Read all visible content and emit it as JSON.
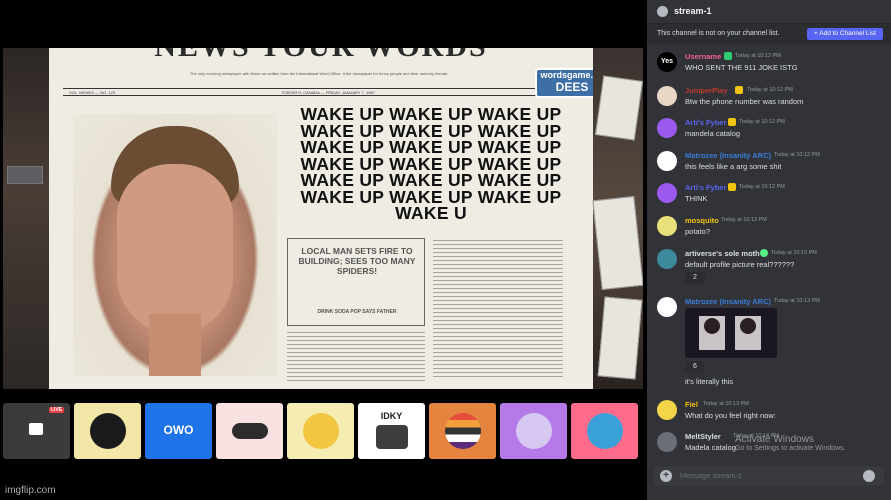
{
  "newspaper": {
    "masthead": "NEWS YOUR WORDS",
    "tagline": "The only morning newspaper with those six written from the International Word Office. It the newspaper for funny people and their unfunny friends.",
    "dateline_left": "VOL. MCMXX — NO. 123",
    "dateline_center": "TORONTO, CANADA — FRIDAY, JANUARY 7, 1967",
    "dateline_right": "EDITION",
    "logo_top": "wordsgame.lol",
    "logo_bottom": "DEES",
    "headline_lines": [
      "WAKE UP WAKE UP WAKE UP",
      "WAKE UP WAKE UP WAKE UP",
      "WAKE UP WAKE UP WAKE UP",
      "WAKE UP WAKE UP WAKE UP",
      "WAKE UP WAKE UP WAKE UP",
      "WAKE UP WAKE UP WAKE UP",
      "WAKE U"
    ],
    "box_title": "LOCAL MAN SETS FIRE TO BUILDING; SEES TOO MANY SPIDERS!",
    "box_sub": "DRINK SODA POP SAYS FATHER"
  },
  "tiles": [
    {
      "bg": "#3b3b3b",
      "label": "",
      "live": "LIVE"
    },
    {
      "bg": "#f3e7a7",
      "label": ""
    },
    {
      "bg": "#1e73e8",
      "label": "OWO"
    },
    {
      "bg": "#f7e1e1",
      "label": ""
    },
    {
      "bg": "#f4ecb0",
      "label": ""
    },
    {
      "bg": "#ffffff",
      "label": "IDKY"
    },
    {
      "bg": "#e4843f",
      "label": ""
    },
    {
      "bg": "#b679e8",
      "label": ""
    },
    {
      "bg": "#ff6b8a",
      "label": ""
    }
  ],
  "watermark": "imgflip.com",
  "chat": {
    "channel_title": "stream-1",
    "notice_text": "This channel is not on your channel list.",
    "notice_button": "+ Add to Channel List",
    "messages": [
      {
        "name": "Username",
        "name_color": "#f06292",
        "time": "Today at 10:12 PM",
        "text": "WHO SENT THE 911 JOKE ISTG",
        "avatar_bg": "#000000",
        "avatar_text": "Yes"
      },
      {
        "name": "JuniperPlay",
        "name_color": "#c0392b",
        "time": "Today at 10:12 PM",
        "text": "Btw the phone number was random",
        "avatar_bg": "#e8d7c5",
        "avatar_text": ""
      },
      {
        "name": "Arti's Fyber",
        "name_color": "#5865f2",
        "time": "Today at 10:12 PM",
        "text": "mandela catalog",
        "avatar_bg": "#9b59f0",
        "avatar_text": ""
      },
      {
        "name": "Matrozee (Insanity ARC)",
        "name_color": "#3a7ddb",
        "time": "Today at 10:12 PM",
        "text": "this feels like a arg some shit",
        "avatar_bg": "#ffffff",
        "avatar_text": ""
      },
      {
        "name": "Arti's Fyber",
        "name_color": "#5865f2",
        "time": "Today at 10:12 PM",
        "text": "THINK",
        "avatar_bg": "#9b59f0",
        "avatar_text": ""
      },
      {
        "name": "mosquito",
        "name_color": "#f1c40f",
        "time": "Today at 10:13 PM",
        "text": "potato?",
        "avatar_bg": "#e8e07a",
        "avatar_text": ""
      },
      {
        "name": "artiverse's sole moth",
        "name_color": "#dbdee1",
        "time": "Today at 10:13 PM",
        "text": "default profile picture real??????",
        "avatar_bg": "#3d8a9c",
        "avatar_text": "",
        "reaction_count": "2"
      },
      {
        "name": "Matrozee (Insanity ARC)",
        "name_color": "#3a7ddb",
        "time": "Today at 10:13 PM",
        "text": "it's literally this",
        "avatar_bg": "#ffffff",
        "avatar_text": "",
        "reaction_count": "6"
      },
      {
        "name": "Fiel",
        "name_color": "#f1c40f",
        "time": "Today at 10:13 PM",
        "text": "What do you feel right now:",
        "avatar_bg": "#f4d54a",
        "avatar_text": ""
      },
      {
        "name": "MeltStyler",
        "name_color": "#dbdee1",
        "time": "Today at 10:14 PM",
        "text": "Madela catalog",
        "avatar_bg": "#6d6f78",
        "avatar_text": ""
      }
    ],
    "input_placeholder": "Message stream-1"
  },
  "windows_activation": {
    "title": "Activate Windows",
    "subtitle": "Go to Settings to activate Windows."
  }
}
